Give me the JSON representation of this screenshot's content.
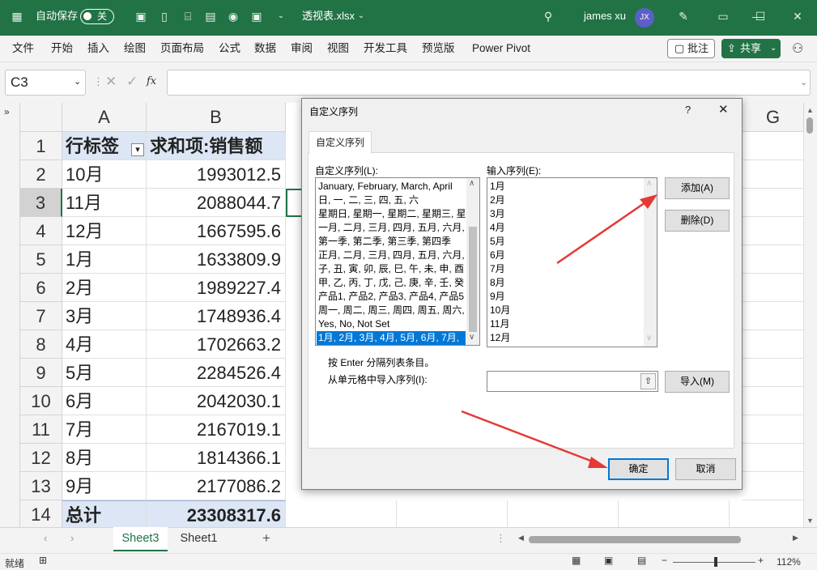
{
  "titlebar": {
    "autosave": "自动保存",
    "toggle": "关",
    "filename": "透视表.xlsx",
    "user": "james xu",
    "avatar": "JX"
  },
  "ribbon": {
    "tabs": [
      "文件",
      "开始",
      "插入",
      "绘图",
      "页面布局",
      "公式",
      "数据",
      "审阅",
      "视图",
      "开发工具",
      "预览版",
      "Power Pivot"
    ],
    "comment_btn": "批注",
    "share_btn": "共享"
  },
  "formula": {
    "namebox": "C3",
    "fx": "fx",
    "value": ""
  },
  "grid": {
    "columns": [
      "A",
      "B",
      "G"
    ],
    "rows": [
      "1",
      "2",
      "3",
      "4",
      "5",
      "6",
      "7",
      "8",
      "9",
      "10",
      "11",
      "12",
      "13",
      "14"
    ],
    "header": {
      "a": "行标签",
      "b": "求和项:销售额"
    },
    "data": [
      {
        "a": "10月",
        "b": "1993012.5"
      },
      {
        "a": "11月",
        "b": "2088044.7"
      },
      {
        "a": "12月",
        "b": "1667595.6"
      },
      {
        "a": "1月",
        "b": "1633809.9"
      },
      {
        "a": "2月",
        "b": "1989227.4"
      },
      {
        "a": "3月",
        "b": "1748936.4"
      },
      {
        "a": "4月",
        "b": "1702663.2"
      },
      {
        "a": "5月",
        "b": "2284526.4"
      },
      {
        "a": "6月",
        "b": "2042030.1"
      },
      {
        "a": "7月",
        "b": "2167019.1"
      },
      {
        "a": "8月",
        "b": "1814366.1"
      },
      {
        "a": "9月",
        "b": "2177086.2"
      }
    ],
    "total": {
      "a": "总计",
      "b": "23308317.6"
    }
  },
  "sheets": [
    "Sheet3",
    "Sheet1"
  ],
  "status": {
    "ready": "就绪",
    "zoom": "112%"
  },
  "dialog": {
    "title": "自定义序列",
    "help": "?",
    "tab": "自定义序列",
    "lists_label": "自定义序列(L):",
    "entries_label": "输入序列(E):",
    "lists": [
      "January, February, March, April",
      "日, 一, 二, 三, 四, 五, 六",
      "星期日, 星期一, 星期二, 星期三, 星",
      "一月, 二月, 三月, 四月, 五月, 六月,",
      "第一季, 第二季, 第三季, 第四季",
      "正月, 二月, 三月, 四月, 五月, 六月,",
      "子, 丑, 寅, 卯, 辰, 巳, 午, 未, 申, 酉",
      "甲, 乙, 丙, 丁, 戊, 己, 庚, 辛, 壬, 癸",
      "产品1, 产品2, 产品3, 产品4, 产品5",
      "周一, 周二, 周三, 周四, 周五, 周六,",
      "Yes, No, Not Set",
      "1月, 2月, 3月, 4月, 5月, 6月, 7月,"
    ],
    "entries": [
      "1月",
      "2月",
      "3月",
      "4月",
      "5月",
      "6月",
      "7月",
      "8月",
      "9月",
      "10月",
      "11月",
      "12月"
    ],
    "add": "添加(A)",
    "delete": "删除(D)",
    "hint": "按 Enter 分隔列表条目。",
    "import_label": "从单元格中导入序列(I):",
    "import": "导入(M)",
    "ok": "确定",
    "cancel": "取消"
  }
}
